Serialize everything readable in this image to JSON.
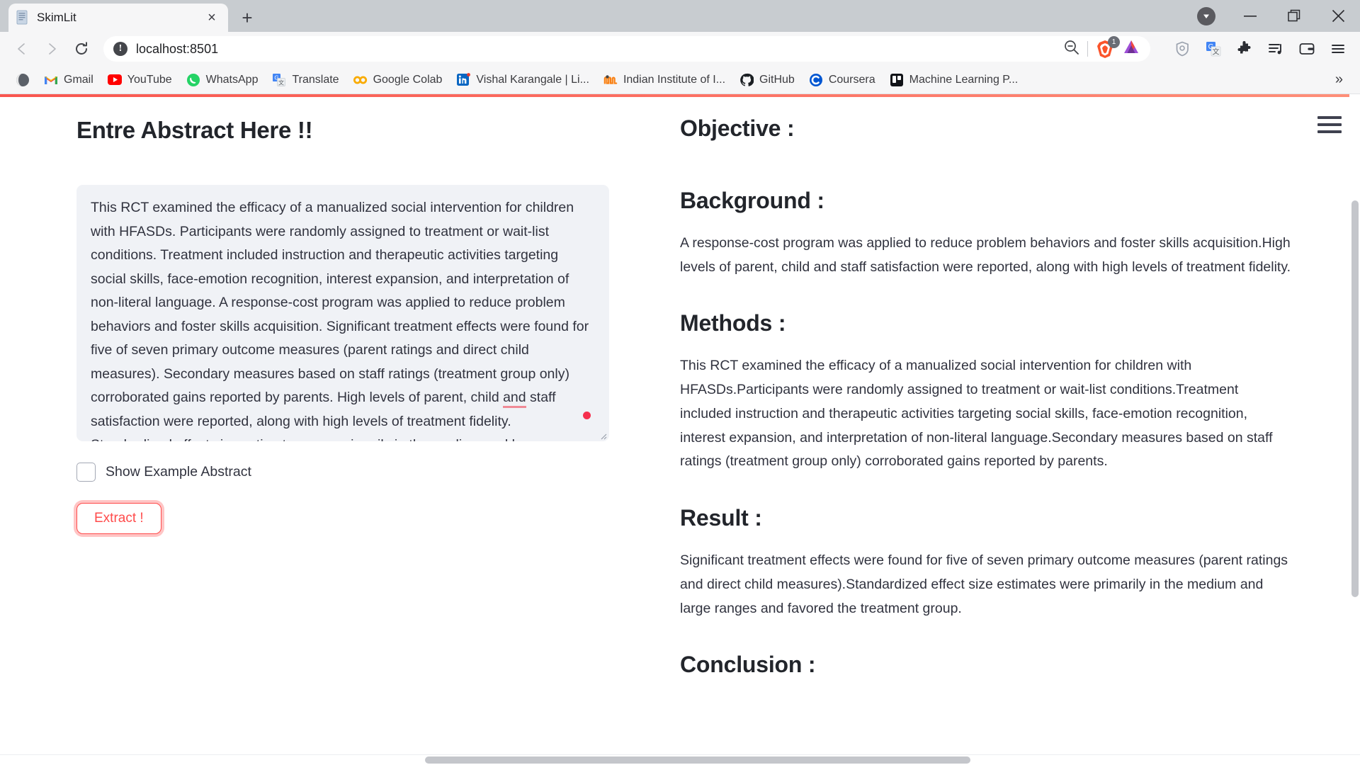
{
  "browser": {
    "tab": {
      "title": "SkimLit",
      "favicon": "document-icon",
      "close": "×"
    },
    "new_tab": "+",
    "window_controls": {
      "downloads": "downloads-icon",
      "minimize": "—",
      "maximize": "❐",
      "close": "✕"
    },
    "nav": {
      "back": "◁",
      "forward": "▷",
      "reload": "↻",
      "bookmark": "bookmark-icon"
    },
    "omnibox": {
      "security_icon": "!",
      "url": "localhost:8501",
      "zoom_out_icon": "zoom-out-icon",
      "brave_shield_count": "1",
      "bat_icon": "brave-rewards-icon"
    },
    "toolbar_right": [
      "vpn-shield-icon",
      "google-translate-icon",
      "extensions-puzzle-icon",
      "playlist-icon",
      "wallet-icon",
      "app-menu-icon"
    ],
    "bookmarks": [
      {
        "label": "",
        "icon": "brave-globe-icon"
      },
      {
        "label": "Gmail",
        "icon": "gmail-icon"
      },
      {
        "label": "YouTube",
        "icon": "youtube-icon"
      },
      {
        "label": "WhatsApp",
        "icon": "whatsapp-icon"
      },
      {
        "label": "Translate",
        "icon": "google-translate-icon"
      },
      {
        "label": "Google Colab",
        "icon": "colab-icon"
      },
      {
        "label": "Vishal Karangale | Li...",
        "icon": "linkedin-icon"
      },
      {
        "label": "Indian Institute of I...",
        "icon": "moodle-icon"
      },
      {
        "label": "GitHub",
        "icon": "github-icon"
      },
      {
        "label": "Coursera",
        "icon": "coursera-icon"
      },
      {
        "label": "Machine Learning P...",
        "icon": "trello-icon"
      }
    ],
    "bookmarks_overflow": "»"
  },
  "app": {
    "menu_icon": "hamburger-menu-icon",
    "left": {
      "header": "Entre Abstract Here !!",
      "abstract_text_before": "This RCT examined the efficacy of a manualized social intervention for children with HFASDs. Participants were randomly assigned to treatment or wait-list conditions. Treatment included instruction and therapeutic activities targeting social skills, face-emotion recognition, interest expansion, and interpretation of non-literal language. A response-cost program was applied to reduce problem behaviors and foster skills acquisition. Significant treatment effects were found for five of seven primary outcome measures (parent ratings and direct child measures). Secondary measures based on staff ratings (treatment group only) corroborated gains reported by parents. High levels of parent, child ",
      "abstract_misspelled": "and",
      "abstract_text_after": " staff satisfaction were reported, along with high levels of treatment fidelity. Standardized effect size estimates were primarily in the medium and large ranges and favored the treatment group.",
      "checkbox_label": "Show Example Abstract",
      "checkbox_checked": false,
      "extract_button": "Extract !"
    },
    "right": {
      "sections": [
        {
          "heading": "Objective :",
          "body": ""
        },
        {
          "heading": "Background :",
          "body": "A response-cost program was applied to reduce problem behaviors and foster skills acquisition.High levels of parent, child and staff satisfaction were reported, along with high levels of treatment fidelity."
        },
        {
          "heading": "Methods :",
          "body": "This RCT examined the efficacy of a manualized social intervention for children with HFASDs.Participants were randomly assigned to treatment or wait-list conditions.Treatment included instruction and therapeutic activities targeting social skills, face-emotion recognition, interest expansion, and interpretation of non-literal language.Secondary measures based on staff ratings (treatment group only) corroborated gains reported by parents."
        },
        {
          "heading": "Result :",
          "body": "Significant treatment effects were found for five of seven primary outcome measures (parent ratings and direct child measures).Standardized effect size estimates were primarily in the medium and large ranges and favored the treatment group."
        },
        {
          "heading": "Conclusion :",
          "body": ""
        }
      ]
    }
  },
  "colors": {
    "accent_red": "#ff4b4b",
    "heading": "#22252b",
    "body_text": "#31333f",
    "textarea_bg": "#f0f2f6"
  }
}
